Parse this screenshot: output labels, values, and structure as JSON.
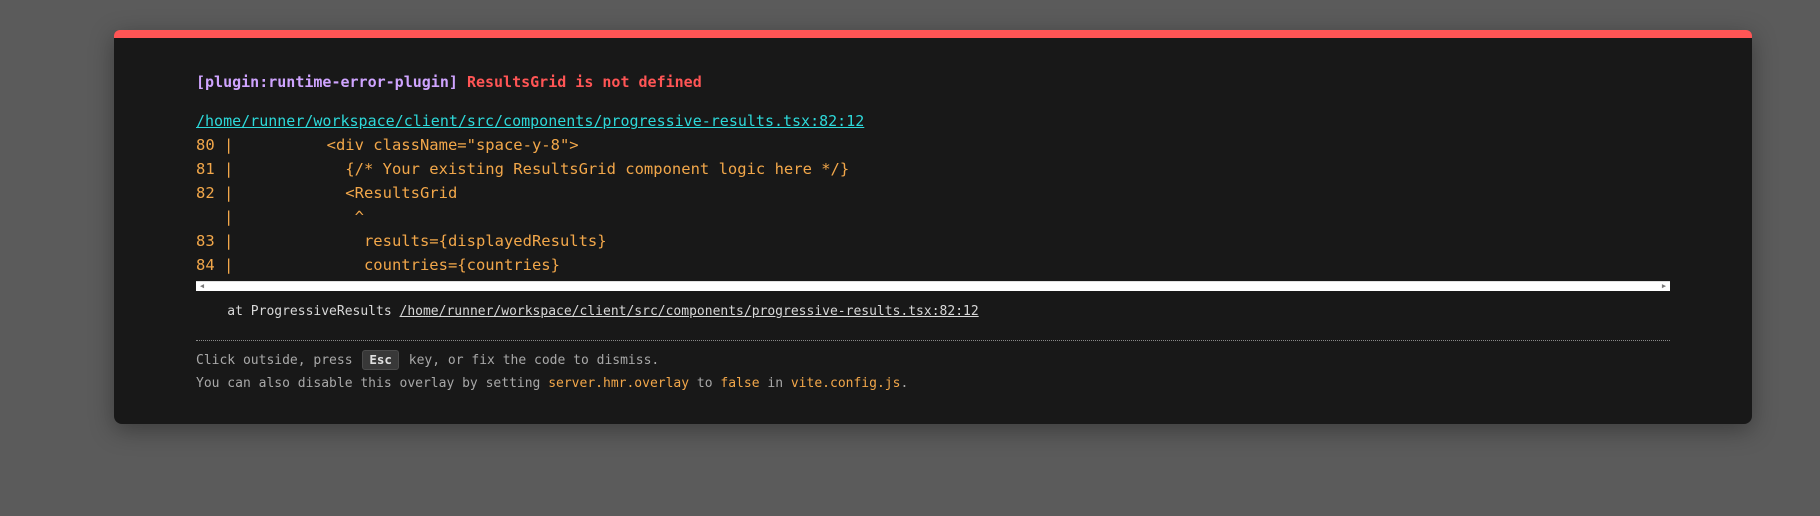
{
  "error": {
    "plugin_tag": "[plugin:runtime-error-plugin]",
    "message": "ResultsGrid is not defined",
    "file": "/home/runner/workspace/client/src/components/progressive-results.tsx:82:12"
  },
  "code_frame": [
    "80 |          <div className=\"space-y-8\">",
    "81 |            {/* Your existing ResultsGrid component logic here */}",
    "82 |            <ResultsGrid",
    "   |             ^",
    "83 |              results={displayedResults}",
    "84 |              countries={countries}"
  ],
  "stack": {
    "prefix": "    at ProgressiveResults ",
    "link": "/home/runner/workspace/client/src/components/progressive-results.tsx:82:12"
  },
  "tip": {
    "line1_before": "Click outside, press ",
    "key": "Esc",
    "line1_after": " key, or fix the code to dismiss.",
    "line2_a": "You can also disable this overlay by setting ",
    "line2_code1": "server.hmr.overlay",
    "line2_b": " to ",
    "line2_code2": "false",
    "line2_c": " in ",
    "line2_code3": "vite.config.js",
    "line2_d": "."
  },
  "scrollbar": {
    "left_icon": "arrow-left-icon",
    "right_icon": "arrow-right-icon"
  },
  "colors": {
    "accent_border": "#ff5555",
    "plugin": "#cfa4ff",
    "error": "#ff5555",
    "file_link": "#2dd9da",
    "code": "#f2a74a"
  }
}
